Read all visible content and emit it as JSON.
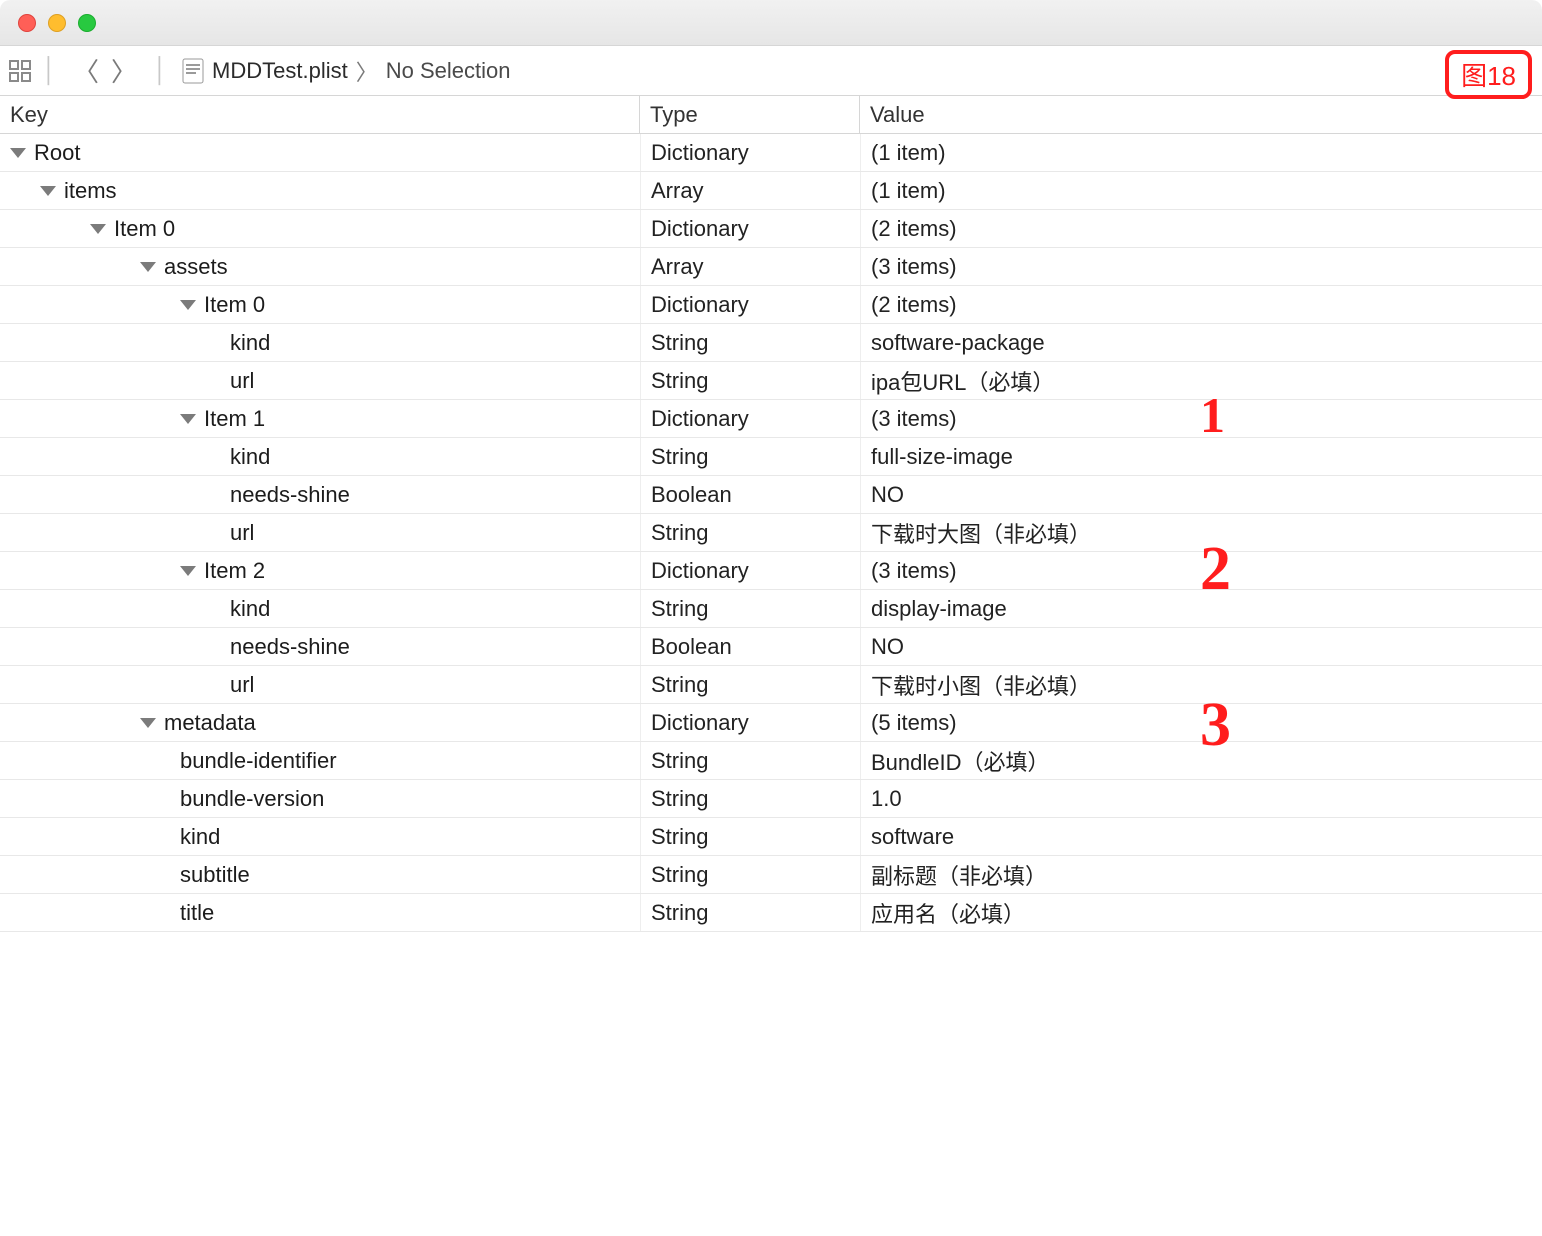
{
  "titlebar": {},
  "toolbar": {
    "filename": "MDDTest.plist",
    "no_selection": "No Selection",
    "figure_tag": "图18"
  },
  "columns": {
    "key": "Key",
    "type": "Type",
    "value": "Value"
  },
  "rows": [
    {
      "indent": 0,
      "disclosure": true,
      "key": "Root",
      "type": "Dictionary",
      "value": "(1 item)",
      "muted": true
    },
    {
      "indent": 1,
      "disclosure": true,
      "key": "items",
      "type": "Array",
      "value": "(1 item)",
      "muted": true
    },
    {
      "indent": 2,
      "disclosure": true,
      "key": "Item 0",
      "type": "Dictionary",
      "value": "(2 items)",
      "muted": true
    },
    {
      "indent": 3,
      "disclosure": true,
      "key": "assets",
      "type": "Array",
      "value": "(3 items)",
      "muted": true
    },
    {
      "indent": 4,
      "disclosure": true,
      "key": "Item 0",
      "type": "Dictionary",
      "value": "(2 items)",
      "muted": true
    },
    {
      "indent": 5,
      "disclosure": false,
      "key": "kind",
      "type": "String",
      "value": "software-package",
      "muted": false
    },
    {
      "indent": 5,
      "disclosure": false,
      "key": "url",
      "type": "String",
      "value": "ipa包URL（必填）",
      "muted": false
    },
    {
      "indent": 4,
      "disclosure": true,
      "key": "Item 1",
      "type": "Dictionary",
      "value": "(3 items)",
      "muted": true
    },
    {
      "indent": 5,
      "disclosure": false,
      "key": "kind",
      "type": "String",
      "value": "full-size-image",
      "muted": false
    },
    {
      "indent": 5,
      "disclosure": false,
      "key": "needs-shine",
      "type": "Boolean",
      "value": "NO",
      "muted": false
    },
    {
      "indent": 5,
      "disclosure": false,
      "key": "url",
      "type": "String",
      "value": "下载时大图（非必填）",
      "muted": false
    },
    {
      "indent": 4,
      "disclosure": true,
      "key": "Item 2",
      "type": "Dictionary",
      "value": "(3 items)",
      "muted": true
    },
    {
      "indent": 5,
      "disclosure": false,
      "key": "kind",
      "type": "String",
      "value": "display-image",
      "muted": false
    },
    {
      "indent": 5,
      "disclosure": false,
      "key": "needs-shine",
      "type": "Boolean",
      "value": "NO",
      "muted": false
    },
    {
      "indent": 5,
      "disclosure": false,
      "key": "url",
      "type": "String",
      "value": "下载时小图（非必填）",
      "muted": false
    },
    {
      "indent": 3,
      "disclosure": true,
      "key": "metadata",
      "type": "Dictionary",
      "value": "(5 items)",
      "muted": true
    },
    {
      "indent": 4,
      "disclosure": false,
      "key": "bundle-identifier",
      "type": "String",
      "value": "BundleID（必填）",
      "muted": false
    },
    {
      "indent": 4,
      "disclosure": false,
      "key": "bundle-version",
      "type": "String",
      "value": "1.0",
      "muted": false
    },
    {
      "indent": 4,
      "disclosure": false,
      "key": "kind",
      "type": "String",
      "value": "software",
      "muted": false
    },
    {
      "indent": 4,
      "disclosure": false,
      "key": "subtitle",
      "type": "String",
      "value": "副标题（非必填）",
      "muted": false
    },
    {
      "indent": 4,
      "disclosure": false,
      "key": "title",
      "type": "String",
      "value": "应用名（必填）",
      "muted": false
    }
  ],
  "annotations": {
    "a1": "1",
    "a2": "2",
    "a3": "3"
  }
}
